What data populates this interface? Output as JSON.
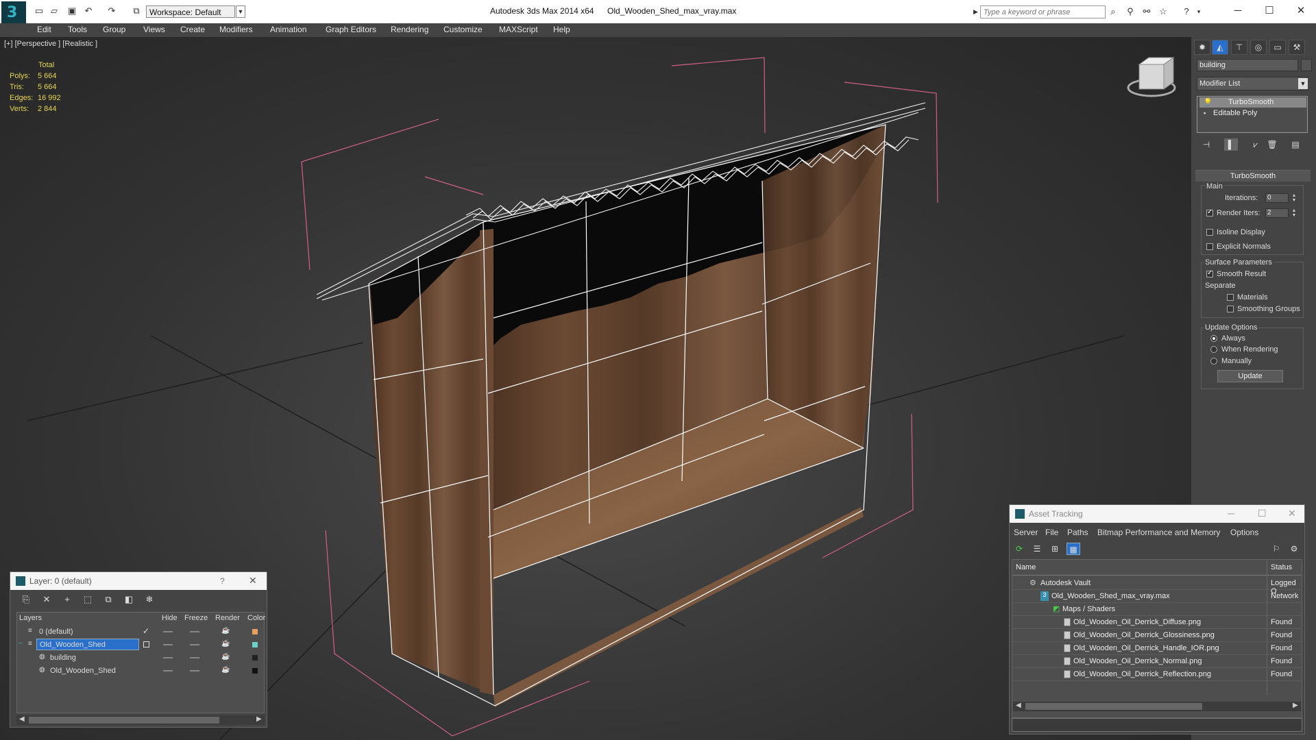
{
  "app": {
    "title": "Autodesk 3ds Max  2014 x64",
    "file_name": "Old_Wooden_Shed_max_vray.max",
    "workspace": "Workspace: Default",
    "search_placeholder": "Type a keyword or phrase"
  },
  "menu": [
    "Edit",
    "Tools",
    "Group",
    "Views",
    "Create",
    "Modifiers",
    "Animation",
    "Graph Editors",
    "Rendering",
    "Customize",
    "MAXScript",
    "Help"
  ],
  "viewport": {
    "label": "[+] [Perspective ] [Realistic ]",
    "stats": {
      "header": "Total",
      "rows": [
        {
          "label": "Polys:",
          "value": "5 664"
        },
        {
          "label": "Tris:",
          "value": "5 664"
        },
        {
          "label": "Edges:",
          "value": "16 992"
        },
        {
          "label": "Verts:",
          "value": "2 844"
        }
      ]
    }
  },
  "command_panel": {
    "object_name": "building",
    "modifier_list": "Modifier List",
    "stack": [
      "TurboSmooth",
      "Editable Poly"
    ],
    "rollout": {
      "title": "TurboSmooth",
      "main_group": "Main",
      "iterations_label": "Iterations:",
      "iterations_value": "0",
      "render_iters_label": "Render Iters:",
      "render_iters_value": "2",
      "isoline": "Isoline Display",
      "explicit_normals": "Explicit Normals",
      "surface_group": "Surface Parameters",
      "smooth_result": "Smooth Result",
      "separate": "Separate",
      "materials": "Materials",
      "smoothing_groups": "Smoothing Groups",
      "update_group": "Update Options",
      "always": "Always",
      "when_rendering": "When Rendering",
      "manually": "Manually",
      "update_button": "Update"
    }
  },
  "layer_dialog": {
    "title": "Layer: 0 (default)",
    "help": "?",
    "columns": [
      "Layers",
      "Hide",
      "Freeze",
      "Render",
      "Color"
    ],
    "rows": [
      {
        "name": "0 (default)",
        "color": "#e8a060"
      },
      {
        "name": "Old_Wooden_Shed",
        "color": "#6ad0c8"
      },
      {
        "name": "building",
        "color": "#222222"
      },
      {
        "name": "Old_Wooden_Shed",
        "color": "#111111"
      }
    ]
  },
  "asset_dialog": {
    "title": "Asset Tracking",
    "menu": [
      "Server",
      "File",
      "Paths",
      "Bitmap Performance and Memory",
      "Options"
    ],
    "columns": [
      "Name",
      "Status"
    ],
    "rows": [
      {
        "name": "Autodesk Vault",
        "status": "Logged O"
      },
      {
        "name": "Old_Wooden_Shed_max_vray.max",
        "status": "Network"
      },
      {
        "name": "Maps / Shaders",
        "status": ""
      },
      {
        "name": "Old_Wooden_Oil_Derrick_Diffuse.png",
        "status": "Found"
      },
      {
        "name": "Old_Wooden_Oil_Derrick_Glossiness.png",
        "status": "Found"
      },
      {
        "name": "Old_Wooden_Oil_Derrick_Handle_IOR.png",
        "status": "Found"
      },
      {
        "name": "Old_Wooden_Oil_Derrick_Normal.png",
        "status": "Found"
      },
      {
        "name": "Old_Wooden_Oil_Derrick_Reflection.png",
        "status": "Found"
      }
    ]
  },
  "colors": {
    "accent": "#36b1c4",
    "selection": "#2a6fc9",
    "bbox": "#d0608a",
    "stats": "#e6d552"
  }
}
